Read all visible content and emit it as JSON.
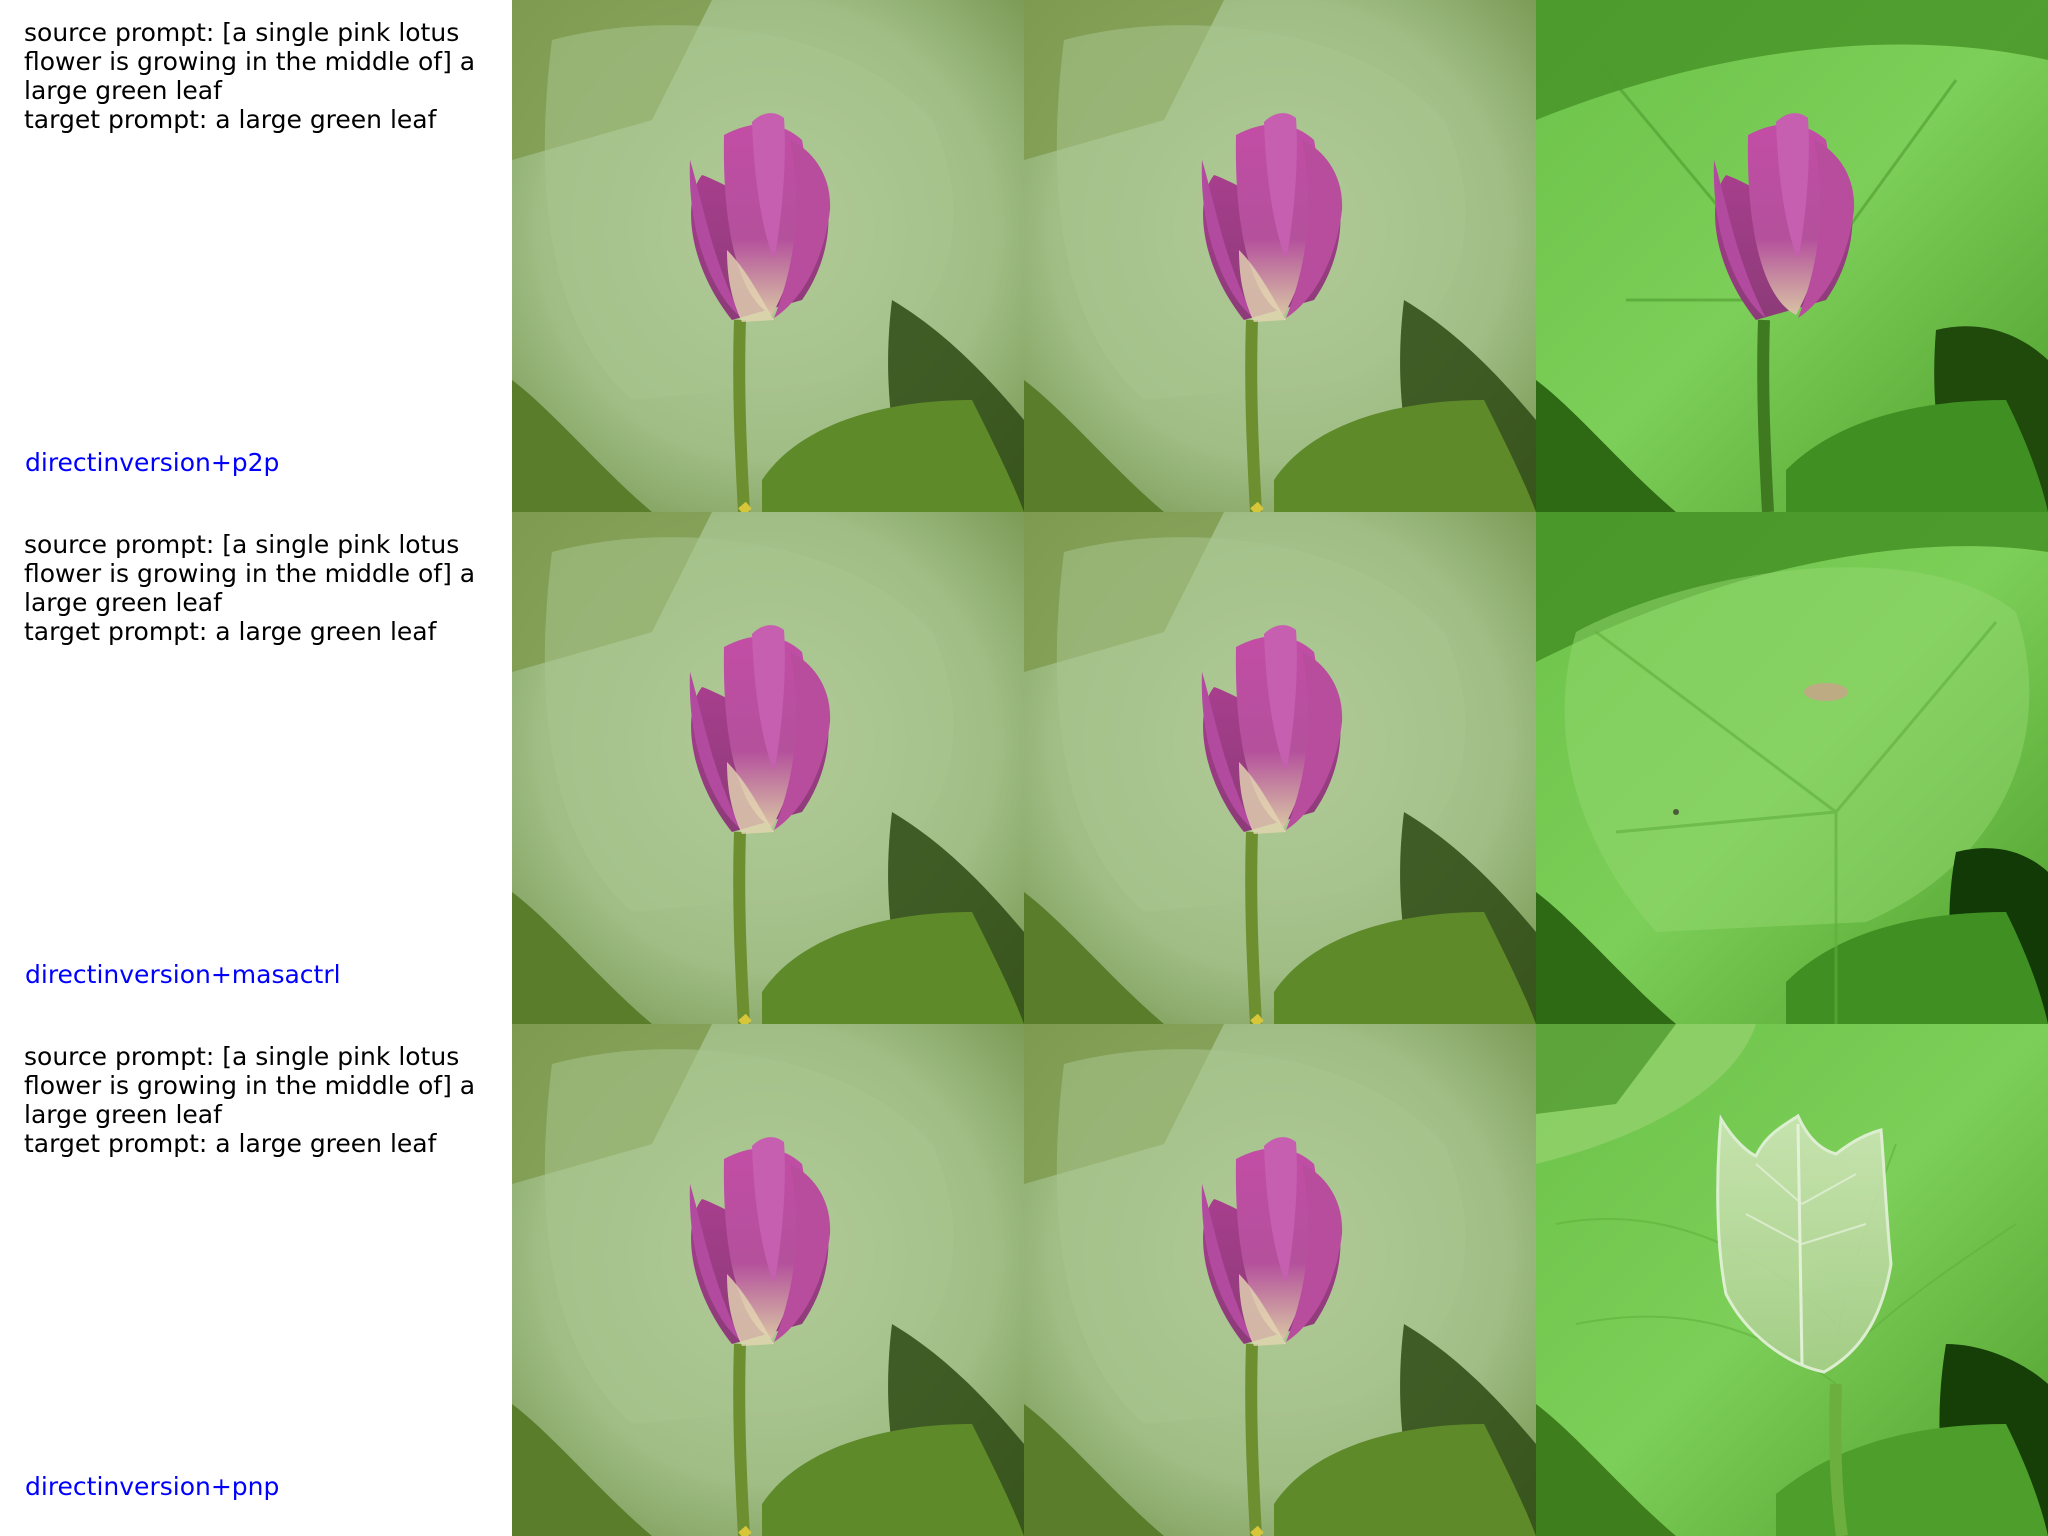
{
  "rows": [
    {
      "source_prompt": "source prompt: [a single pink lotus flower is growing in the middle of] a large green leaf",
      "target_prompt": "target prompt: a large green leaf",
      "method": "directinversion+p2p",
      "edited_image": "lotus-bud-on-bright-leaf"
    },
    {
      "source_prompt": "source prompt: [a single pink lotus flower is growing in the middle of] a large green leaf",
      "target_prompt": "target prompt: a large green leaf",
      "method": "directinversion+masactrl",
      "edited_image": "bare-leaf-with-small-blemish"
    },
    {
      "source_prompt": "source prompt: [a single pink lotus flower is growing in the middle of] a large green leaf",
      "target_prompt": "target prompt: a large green leaf",
      "method": "directinversion+pnp",
      "edited_image": "translucent-leaf-shape-on-stem"
    }
  ],
  "colors": {
    "caption_text": "#000000",
    "method_label": "#0000ff",
    "background": "#ffffff"
  }
}
